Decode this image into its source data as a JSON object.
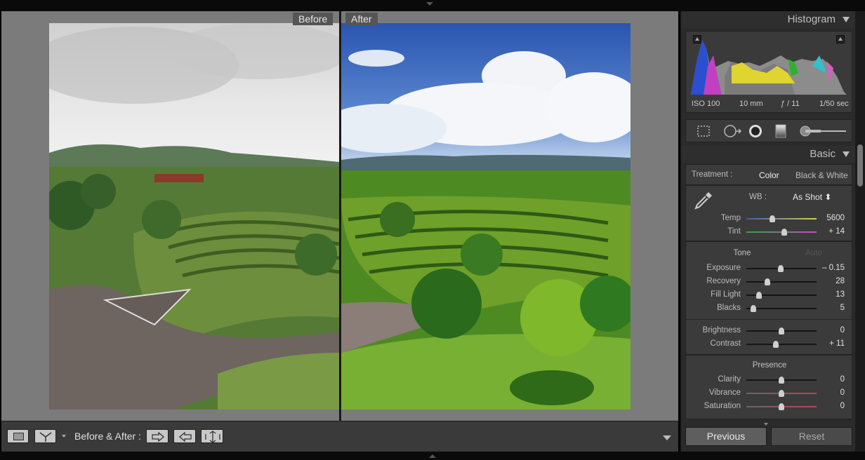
{
  "compare": {
    "before_label": "Before",
    "after_label": "After"
  },
  "toolbar": {
    "before_after_label": "Before & After :"
  },
  "histogram": {
    "title": "Histogram",
    "iso": "ISO 100",
    "focal": "10 mm",
    "aperture": "ƒ / 11",
    "shutter": "1/50 sec"
  },
  "basic": {
    "title": "Basic",
    "treatment_label": "Treatment :",
    "treatment_color": "Color",
    "treatment_bw": "Black & White",
    "wb_label": "WB :",
    "wb_value": "As Shot ⬍",
    "tone_label": "Tone",
    "auto_label": "Auto",
    "presence_label": "Presence",
    "sliders": {
      "temp": {
        "label": "Temp",
        "value": "5600",
        "pos": 0.37
      },
      "tint": {
        "label": "Tint",
        "value": "+ 14",
        "pos": 0.54
      },
      "exposure": {
        "label": "Exposure",
        "value": "– 0.15",
        "pos": 0.49
      },
      "recovery": {
        "label": "Recovery",
        "value": "28",
        "pos": 0.3
      },
      "fill_light": {
        "label": "Fill Light",
        "value": "13",
        "pos": 0.18
      },
      "blacks": {
        "label": "Blacks",
        "value": "5",
        "pos": 0.1
      },
      "brightness": {
        "label": "Brightness",
        "value": "0",
        "pos": 0.5
      },
      "contrast": {
        "label": "Contrast",
        "value": "+ 11",
        "pos": 0.42
      },
      "clarity": {
        "label": "Clarity",
        "value": "0",
        "pos": 0.5
      },
      "vibrance": {
        "label": "Vibrance",
        "value": "0",
        "pos": 0.5
      },
      "saturation": {
        "label": "Saturation",
        "value": "0",
        "pos": 0.5
      }
    }
  },
  "buttons": {
    "previous": "Previous",
    "reset": "Reset"
  }
}
